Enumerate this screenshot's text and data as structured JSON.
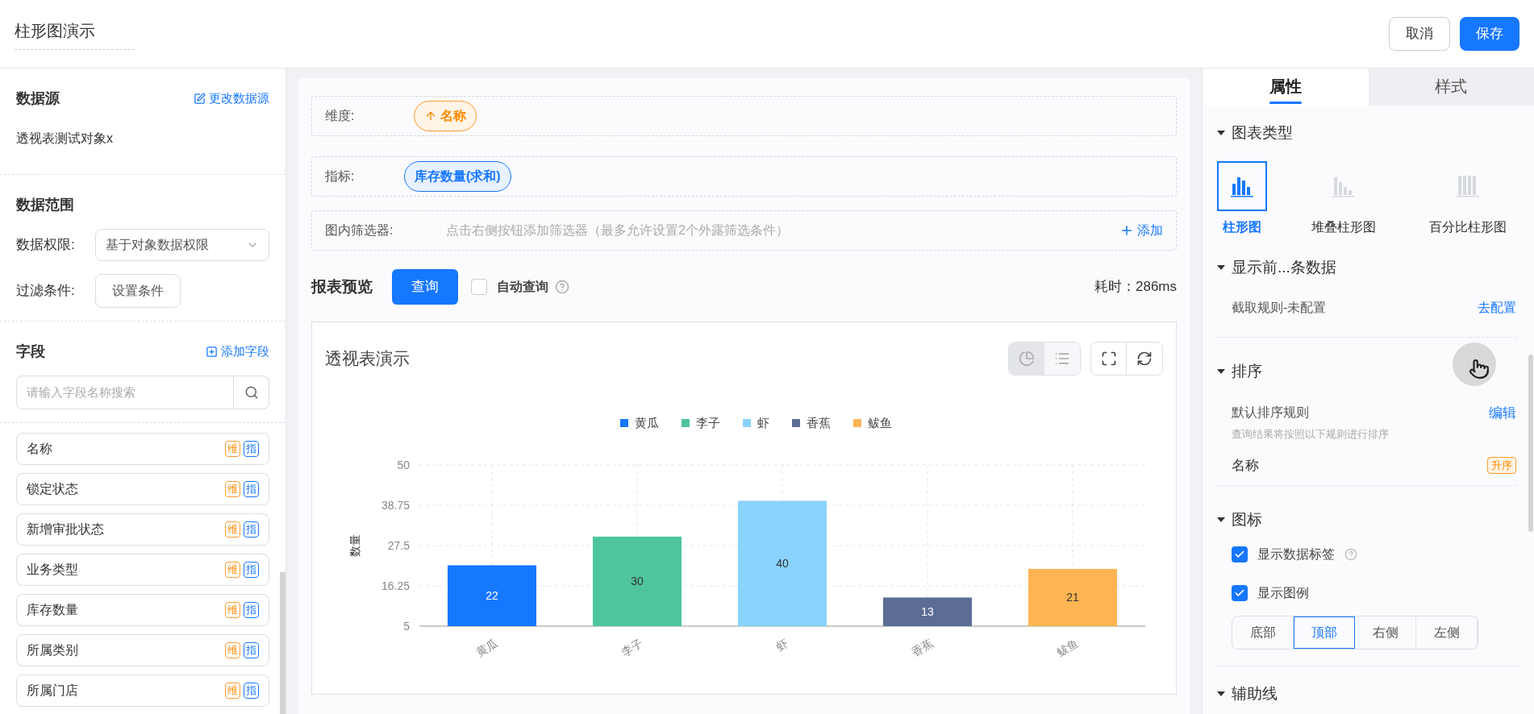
{
  "header": {
    "title": "柱形图演示",
    "buttons": [
      {
        "label": "取消",
        "kind": "secondary"
      },
      {
        "label": "保存",
        "kind": "primary"
      }
    ]
  },
  "left": {
    "data_source": {
      "title": "数据源",
      "action": "更改数据源",
      "value": "透视表测试对象x"
    },
    "data_range": {
      "title": "数据范围",
      "permission_label": "数据权限:",
      "permission_value": "基于对象数据权限",
      "filter_label": "过滤条件:",
      "filter_button": "设置条件"
    },
    "fields": {
      "title": "字段",
      "action": "添加字段",
      "search_placeholder": "请输入字段名称搜索",
      "items": [
        {
          "name": "名称",
          "dim_tag": "维",
          "metric_tag": "指"
        },
        {
          "name": "锁定状态",
          "dim_tag": "维",
          "metric_tag": "指"
        },
        {
          "name": "新增审批状态",
          "dim_tag": "维",
          "metric_tag": "指"
        },
        {
          "name": "业务类型",
          "dim_tag": "维",
          "metric_tag": "指"
        },
        {
          "name": "库存数量",
          "dim_tag": "维",
          "metric_tag": "指"
        },
        {
          "name": "所属类别",
          "dim_tag": "维",
          "metric_tag": "指"
        },
        {
          "name": "所属门店",
          "dim_tag": "维",
          "metric_tag": "指"
        }
      ]
    }
  },
  "config": {
    "dimension": {
      "label": "维度:",
      "chip": "名称"
    },
    "metric": {
      "label": "指标:",
      "chip": "库存数量(求和)"
    },
    "filter": {
      "label": "图内筛选器:",
      "hint": "点击右侧按钮添加筛选器（最多允许设置2个外露筛选条件）",
      "action": "添加"
    }
  },
  "preview": {
    "title": "报表预览",
    "query_button": "查询",
    "auto_query": {
      "label": "自动查询",
      "checked": false
    },
    "elapsed": "耗时：286ms"
  },
  "chart_card": {
    "title": "透视表演示",
    "view_toggle": [
      {
        "kind": "chart",
        "selected": true
      },
      {
        "kind": "list",
        "selected": false
      }
    ],
    "chart_data": {
      "type": "bar",
      "ylabel": "数量",
      "categories": [
        "黄瓜",
        "李子",
        "虾",
        "香蕉",
        "鲅鱼"
      ],
      "series": [
        {
          "name": "黄瓜",
          "color": "#1677ff",
          "values": [
            22,
            null,
            null,
            null,
            null
          ]
        },
        {
          "name": "李子",
          "color": "#4fc59b",
          "values": [
            null,
            30,
            null,
            null,
            null
          ]
        },
        {
          "name": "虾",
          "color": "#8ad3ff",
          "values": [
            null,
            null,
            40,
            null,
            null
          ]
        },
        {
          "name": "香蕉",
          "color": "#5b6d95",
          "values": [
            null,
            null,
            null,
            13,
            null
          ]
        },
        {
          "name": "鲅鱼",
          "color": "#ffb453",
          "values": [
            null,
            null,
            null,
            null,
            21
          ]
        }
      ],
      "ylim": [
        5,
        50
      ],
      "yticks": [
        5,
        {
          "value": 16.25,
          "label": "16.25"
        },
        {
          "value": 27.5,
          "label": "27.5"
        },
        {
          "value": 38.75,
          "label": "38.75"
        },
        50
      ],
      "data_labels": true,
      "grid": true
    }
  },
  "properties": {
    "tabs": [
      {
        "label": "属性",
        "selected": true
      },
      {
        "label": "样式",
        "selected": false
      }
    ],
    "chart_type": {
      "title": "图表类型",
      "options": [
        {
          "label": "柱形图",
          "kind": "bar",
          "selected": true
        },
        {
          "label": "堆叠柱形图",
          "kind": "stacked",
          "selected": false
        },
        {
          "label": "百分比柱形图",
          "kind": "percent",
          "selected": false
        }
      ]
    },
    "top_n": {
      "title": "显示前...条数据",
      "rule": "截取规则-未配置",
      "action": "去配置"
    },
    "sort": {
      "title": "排序",
      "rule_title": "默认排序规则",
      "action": "编辑",
      "hint": "查询结果将按照以下规则进行排序",
      "items": [
        {
          "field": "名称",
          "order": "升序"
        }
      ]
    },
    "legend": {
      "title": "图标",
      "options": [
        {
          "label": "显示数据标签",
          "checked": true,
          "help": true
        },
        {
          "label": "显示图例",
          "checked": true,
          "help": false
        }
      ],
      "positions": [
        {
          "label": "底部",
          "selected": false
        },
        {
          "label": "顶部",
          "selected": true
        },
        {
          "label": "右侧",
          "selected": false
        },
        {
          "label": "左侧",
          "selected": false
        }
      ]
    },
    "guides": {
      "title": "辅助线"
    }
  }
}
